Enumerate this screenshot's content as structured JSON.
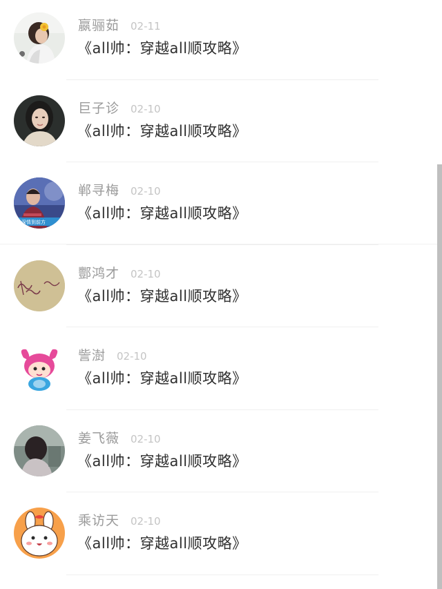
{
  "items": [
    {
      "name": "嬴骊茹",
      "date": "02-11",
      "title": "《all帅：穿越all顺攻略》",
      "avatar": "photo-girl-flower"
    },
    {
      "name": "巨子诊",
      "date": "02-10",
      "title": "《all帅：穿越all顺攻略》",
      "avatar": "photo-woman-portrait"
    },
    {
      "name": "郸寻梅",
      "date": "02-10",
      "title": "《all帅：穿越all顺攻略》",
      "avatar": "photo-man-stage"
    },
    {
      "name": "酆鸿才",
      "date": "02-10",
      "title": "《all帅：穿越all顺攻略》",
      "avatar": "handwriting-paper"
    },
    {
      "name": "訾澍",
      "date": "02-10",
      "title": "《all帅：穿越all顺攻略》",
      "avatar": "cartoon-pink-devil"
    },
    {
      "name": "姜飞薇",
      "date": "02-10",
      "title": "《all帅：穿越all顺攻略》",
      "avatar": "photo-girl-back"
    },
    {
      "name": "乘访天",
      "date": "02-10",
      "title": "《all帅：穿越all顺攻略》",
      "avatar": "cartoon-bunny"
    }
  ],
  "colors": {
    "name": "#9a9a9a",
    "date": "#c4c4c4",
    "title": "#2e2e2e",
    "separator": "#efefef",
    "scrollbar": "#bfbfbf"
  }
}
